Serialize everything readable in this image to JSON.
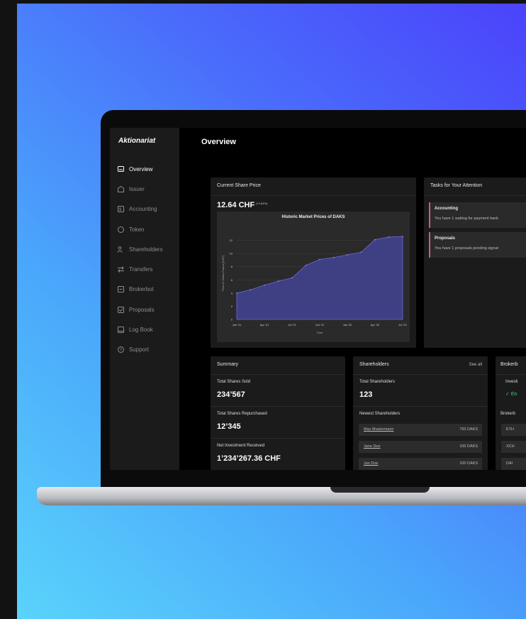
{
  "app": {
    "brand": "Aktionariat",
    "page_title": "Overview"
  },
  "sidebar": {
    "items": [
      {
        "label": "Overview",
        "icon": "overview-icon",
        "active": true
      },
      {
        "label": "Issuer",
        "icon": "issuer-icon"
      },
      {
        "label": "Accounting",
        "icon": "accounting-icon"
      },
      {
        "label": "Token",
        "icon": "token-icon"
      },
      {
        "label": "Shareholders",
        "icon": "shareholders-icon"
      },
      {
        "label": "Transfers",
        "icon": "transfers-icon"
      },
      {
        "label": "Brokerbot",
        "icon": "brokerbot-icon"
      },
      {
        "label": "Proposals",
        "icon": "proposals-icon"
      },
      {
        "label": "Log Book",
        "icon": "logbook-icon"
      },
      {
        "label": "Support",
        "icon": "support-icon"
      }
    ]
  },
  "share_price": {
    "title": "Current Share Price",
    "value": "12.64 CHF",
    "change": "(+0.64%)"
  },
  "chart_data": {
    "type": "area",
    "title": "Historic Market Prices of DAKS",
    "xlabel": "Time",
    "ylabel": "Price in Swiss Francs [CHF]",
    "x_ticks": [
      "Jan '21",
      "Apr '21",
      "Jul '21",
      "Oct '21",
      "Jan '22",
      "Apr '22",
      "Jul '22"
    ],
    "y_ticks": [
      0,
      2,
      4,
      6,
      8,
      10,
      12
    ],
    "ylim": [
      0,
      14
    ],
    "x": [
      0,
      0.5,
      1,
      1.5,
      2,
      2.5,
      3,
      3.5,
      4,
      4.5,
      5,
      5.5,
      6
    ],
    "values": [
      4.0,
      4.5,
      5.2,
      5.8,
      6.3,
      8.2,
      9.1,
      9.4,
      9.8,
      10.2,
      12.1,
      12.5,
      12.6
    ]
  },
  "tasks": {
    "title": "Tasks for Your Attention",
    "items": [
      {
        "title": "Accounting",
        "desc": "You have 1 waiting for payment bank"
      },
      {
        "title": "Proposals",
        "desc": "You have 1 proposals pending signat"
      }
    ]
  },
  "summary": {
    "title": "Summary",
    "sold_label": "Total Shares Sold",
    "sold_value": "234’567",
    "repurchased_label": "Total Shares Repurchased",
    "repurchased_value": "12’345",
    "investment_label": "Net Investment Received",
    "investment_value": "1’234’267.36 CHF"
  },
  "shareholders": {
    "title": "Shareholders",
    "see_all": "See all",
    "total_label": "Total Shareholders",
    "total_value": "123",
    "newest_label": "Newest Shareholders",
    "rows": [
      {
        "name": "Max Mustermann",
        "value": "793 DAKS"
      },
      {
        "name": "Jane Doe",
        "value": "100 DAKS"
      },
      {
        "name": "Jon Doe",
        "value": "100 DAKS"
      }
    ]
  },
  "brokerbot": {
    "title": "Brokerb",
    "invest_label": "Investi",
    "status": "En",
    "sub_label": "Brokerb",
    "rows": [
      "ETH",
      "XCH",
      "DAI"
    ]
  }
}
